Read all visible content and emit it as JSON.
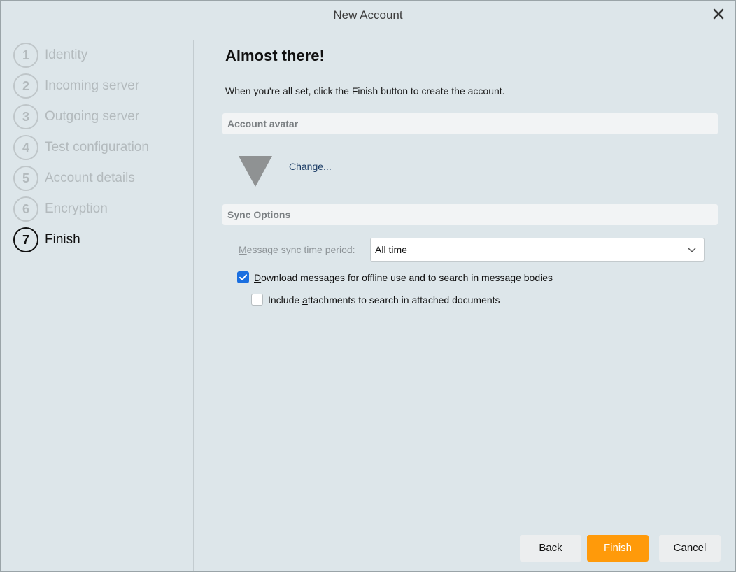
{
  "window": {
    "title": "New Account"
  },
  "steps": [
    {
      "num": "1",
      "label": "Identity"
    },
    {
      "num": "2",
      "label": "Incoming server"
    },
    {
      "num": "3",
      "label": "Outgoing server"
    },
    {
      "num": "4",
      "label": "Test configuration"
    },
    {
      "num": "5",
      "label": "Account details"
    },
    {
      "num": "6",
      "label": "Encryption"
    },
    {
      "num": "7",
      "label": "Finish"
    }
  ],
  "active_step": 7,
  "main": {
    "heading": "Almost there!",
    "intro": "When you're all set, click the Finish button to create the account.",
    "avatar_section": "Account avatar",
    "change_link": "Change...",
    "sync_section": "Sync Options",
    "sync_label_first": "M",
    "sync_label_rest": "essage sync time period:",
    "sync_value": "All time",
    "download_first": "D",
    "download_rest": "ownload messages for offline use and to search in message bodies",
    "download_checked": true,
    "attach_pre": "Include ",
    "attach_u": "a",
    "attach_rest": "ttachments to search in attached documents",
    "attach_checked": false
  },
  "buttons": {
    "back_u": "B",
    "back_rest": "ack",
    "finish_pre": "Fi",
    "finish_u": "n",
    "finish_rest": "ish",
    "cancel": "Cancel"
  },
  "colors": {
    "accent": "#1a6fe0",
    "finish": "#ff9a0a",
    "background": "#dde6ea"
  },
  "icons": {
    "close": "close-icon",
    "avatar": "avatar-triangle-icon",
    "chevron": "chevron-down-icon",
    "check": "check-icon"
  }
}
